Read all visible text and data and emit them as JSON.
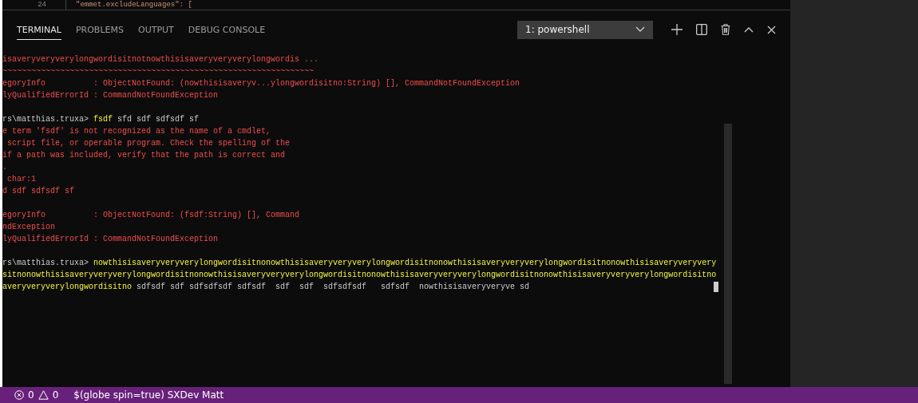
{
  "editor": {
    "line_number": "24",
    "code": "\"emmet.excludeLanguages\": ["
  },
  "panel": {
    "tabs": [
      {
        "label": "TERMINAL",
        "selected": true
      },
      {
        "label": "PROBLEMS",
        "selected": false
      },
      {
        "label": "OUTPUT",
        "selected": false
      },
      {
        "label": "DEBUG CONSOLE",
        "selected": false
      }
    ],
    "terminal_select": {
      "value": "1: powershell"
    }
  },
  "terminal": {
    "lines": [
      {
        "kind": "text",
        "segments": [
          {
            "kind": "error",
            "text": "isaveryveryverylongwordisitnotnowthisisaveryveryverylongwordis ..."
          }
        ]
      },
      {
        "kind": "text",
        "segments": [
          {
            "kind": "error",
            "text": "~~~~~~~~~~~~~~~~~~~~~~~~~~~~~~~~~~~~~~~~~~~~~~~~~~~~~~~~~~~~~~~~~"
          }
        ]
      },
      {
        "kind": "text",
        "segments": [
          {
            "kind": "error",
            "text": "egoryInfo          : ObjectNotFound: (nowthisisaveryv...ylongwordisitno:String) [], CommandNotFoundException"
          }
        ]
      },
      {
        "kind": "text",
        "segments": [
          {
            "kind": "error",
            "text": "lyQualifiedErrorId : CommandNotFoundException"
          }
        ]
      },
      {
        "kind": "blank"
      },
      {
        "kind": "text",
        "segments": [
          {
            "kind": "prompt",
            "text": "rs\\matthias.truxa> "
          },
          {
            "kind": "command",
            "text": "fsdf"
          },
          {
            "kind": "prompt",
            "text": " sfd sdf sdfsdf sf"
          }
        ]
      },
      {
        "kind": "text",
        "segments": [
          {
            "kind": "error",
            "text": "e term 'fsdf' is not recognized as the name of a cmdlet,"
          }
        ]
      },
      {
        "kind": "text",
        "segments": [
          {
            "kind": "error",
            "text": " script file, or operable program. Check the spelling of the"
          }
        ]
      },
      {
        "kind": "text",
        "segments": [
          {
            "kind": "error",
            "text": "if a path was included, verify that the path is correct and"
          }
        ]
      },
      {
        "kind": "text",
        "segments": [
          {
            "kind": "error",
            "text": "."
          }
        ]
      },
      {
        "kind": "text",
        "segments": [
          {
            "kind": "error",
            "text": " char:1"
          }
        ]
      },
      {
        "kind": "text",
        "segments": [
          {
            "kind": "error",
            "text": "d sdf sdfsdf sf"
          }
        ]
      },
      {
        "kind": "blank"
      },
      {
        "kind": "text",
        "segments": [
          {
            "kind": "error",
            "text": "egoryInfo          : ObjectNotFound: (fsdf:String) [], Command"
          }
        ]
      },
      {
        "kind": "text",
        "segments": [
          {
            "kind": "error",
            "text": "ndException"
          }
        ]
      },
      {
        "kind": "text",
        "segments": [
          {
            "kind": "error",
            "text": "lyQualifiedErrorId : CommandNotFoundException"
          }
        ]
      },
      {
        "kind": "blank"
      },
      {
        "kind": "text",
        "segments": [
          {
            "kind": "prompt",
            "text": "rs\\matthias.truxa> "
          },
          {
            "kind": "command",
            "text": "nowthisisaveryveryverylongwordisitnonowthisisaveryveryverylongwordisitnonowthisisaveryveryverylongwordisitnonowthisisaveryveryvery"
          }
        ]
      },
      {
        "kind": "text",
        "segments": [
          {
            "kind": "command",
            "text": "sitnonowthisisaveryveryverylongwordisitnonowthisisaveryveryverylongwordisitnonowthisisaveryveryverylongwordisitnonowthisisaveryveryverylongwordisitno"
          }
        ]
      },
      {
        "kind": "text",
        "cursor": true,
        "segments": [
          {
            "kind": "command",
            "text": "averyveryverylongwordisitno"
          },
          {
            "kind": "prompt",
            "text": " sdfsdf sdf sdfsdfsdf sdfsdf  sdf  sdf  sdfsdfsdf   sdfsdf  nowthisisaveryveryve sd"
          }
        ]
      }
    ]
  },
  "status_bar": {
    "errors": "0",
    "warnings": "0",
    "text": "$(globe spin=true) SXDev Matt"
  }
}
